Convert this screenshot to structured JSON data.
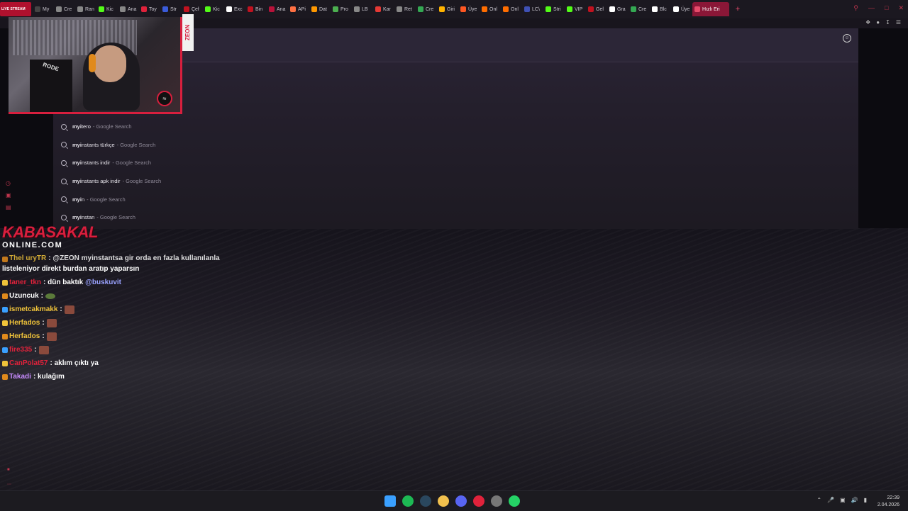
{
  "browser": {
    "tabs": [
      {
        "label": "LIVE STREAM",
        "color": "#b0112e",
        "live": true
      },
      {
        "label": "My",
        "color": "#444"
      },
      {
        "label": "Cre",
        "color": "#888"
      },
      {
        "label": "Ran",
        "color": "#888"
      },
      {
        "label": "Kic",
        "color": "#53fc18"
      },
      {
        "label": "Ana",
        "color": "#888"
      },
      {
        "label": "Toy",
        "color": "#e0223b"
      },
      {
        "label": "Str",
        "color": "#3a5bd9"
      },
      {
        "label": "Çeł",
        "color": "#c1121f"
      },
      {
        "label": "Kic",
        "color": "#53fc18"
      },
      {
        "label": "Exc",
        "color": "#fff"
      },
      {
        "label": "Bin",
        "color": "#c1121f"
      },
      {
        "label": "Ana",
        "color": "#b8123a"
      },
      {
        "label": "APi",
        "color": "#ff7043"
      },
      {
        "label": "Dat",
        "color": "#ff9800"
      },
      {
        "label": "Pro",
        "color": "#4caf50"
      },
      {
        "label": "LB",
        "color": "#888"
      },
      {
        "label": "Kar",
        "color": "#e53935"
      },
      {
        "label": "Ret",
        "color": "#888"
      },
      {
        "label": "Cre",
        "color": "#34a853"
      },
      {
        "label": "Giri",
        "color": "#ffb300"
      },
      {
        "label": "Üye",
        "color": "#ff5722"
      },
      {
        "label": "Onl",
        "color": "#ff6d00"
      },
      {
        "label": "Onl",
        "color": "#ff6d00"
      },
      {
        "label": "LC\\",
        "color": "#3f51b5"
      },
      {
        "label": "Stri",
        "color": "#53fc18"
      },
      {
        "label": "VIP",
        "color": "#53fc18"
      },
      {
        "label": "Gel",
        "color": "#c1121f"
      },
      {
        "label": "Gra",
        "color": "#fff"
      },
      {
        "label": "Cre",
        "color": "#34a853"
      },
      {
        "label": "Blc",
        "color": "#fff"
      },
      {
        "label": "Üye",
        "color": "#fff"
      },
      {
        "label": "Hızlı Eri",
        "color": "#e64b6b",
        "active": true
      }
    ],
    "new_tab": "+"
  },
  "omnibox": {
    "suggestions": [
      {
        "bold": "myi",
        "rest": "tero",
        "source": "- Google Search"
      },
      {
        "bold": "myi",
        "rest": "nstants türkçe",
        "source": "- Google Search"
      },
      {
        "bold": "myi",
        "rest": "nstants indir",
        "source": "- Google Search"
      },
      {
        "bold": "myi",
        "rest": "nstants apk indir",
        "source": "- Google Search"
      },
      {
        "bold": "myi",
        "rest": "n",
        "source": "- Google Search"
      },
      {
        "bold": "myi",
        "rest": "nstan",
        "source": "- Google Search"
      }
    ]
  },
  "overlay": {
    "zeon": "ZEON",
    "brand_top": "KABASAKAL",
    "brand_bottom": "ONLINE.COM"
  },
  "chat": {
    "messages": [
      {
        "user": "Thel uryTR",
        "user_color": "#f0c33a",
        "text": ": @ZEON myinstantsa gir orda en fazla kullanılanla",
        "partial": true
      },
      {
        "user": "",
        "user_color": "#fff",
        "text": "listeleniyor direkt burdan aratıp yaparsın"
      },
      {
        "user": "taner_tkn",
        "user_color": "#e0223b",
        "text": ": dün baktık",
        "mention": "@buskuvit"
      },
      {
        "user": "Uzuncuk",
        "user_color": "#fff",
        "text": ":",
        "emote": "green"
      },
      {
        "user": "ismetcakmakk",
        "user_color": "#f0c33a",
        "text": ":",
        "emote": "red"
      },
      {
        "user": "Herfados",
        "user_color": "#f0c33a",
        "text": ":",
        "emote": "red"
      },
      {
        "user": "Herfados",
        "user_color": "#f0c33a",
        "text": ":",
        "emote": "red"
      },
      {
        "user": "fire335",
        "user_color": "#e0223b",
        "text": ":",
        "emote": "red"
      },
      {
        "user": "CanPolat57",
        "user_color": "#e0223b",
        "text": ": aklım çıktı ya"
      },
      {
        "user": "Takadi",
        "user_color": "#c88cff",
        "text": ": kulağım"
      }
    ]
  },
  "taskbar": {
    "time": "22:39",
    "date": "2.04.2026",
    "apps": [
      {
        "name": "windows",
        "color": "#3aa0ff"
      },
      {
        "name": "spotify",
        "color": "#1db954"
      },
      {
        "name": "steam",
        "color": "#2a475e"
      },
      {
        "name": "file-explorer",
        "color": "#f2c14e"
      },
      {
        "name": "discord",
        "color": "#5865f2"
      },
      {
        "name": "opera-gx",
        "color": "#e0223b"
      },
      {
        "name": "chrome",
        "color": "#777"
      },
      {
        "name": "whatsapp",
        "color": "#25d366"
      }
    ]
  }
}
